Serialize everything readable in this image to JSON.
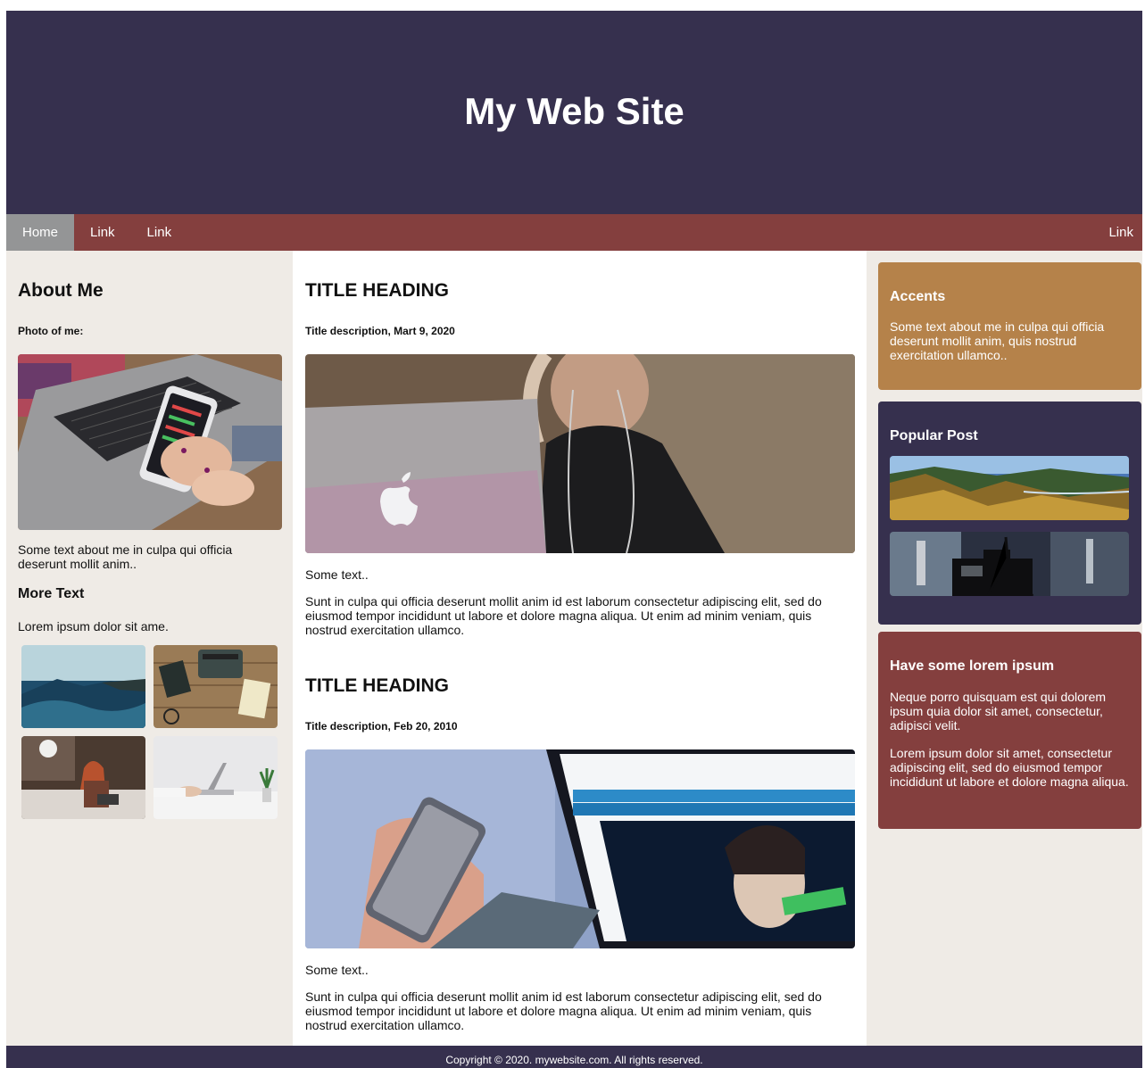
{
  "header": {
    "title": "My Web Site"
  },
  "nav": {
    "items": [
      {
        "label": "Home",
        "active": true
      },
      {
        "label": "Link",
        "active": false
      },
      {
        "label": "Link",
        "active": false
      }
    ],
    "right_item": {
      "label": "Link"
    }
  },
  "left": {
    "heading": "About Me",
    "photo_label": "Photo of me:",
    "photo_icon": "laptop-phone-photo",
    "about_text": "Some text about me in culpa qui officia deserunt mollit anim..",
    "more_heading": "More Text",
    "more_line": "Lorem ipsum dolor sit ame."
  },
  "articles": [
    {
      "title": "TITLE HEADING",
      "description": "Title description, Mart 9, 2020",
      "some_text": "Some text..",
      "body": "Sunt in culpa qui officia deserunt mollit anim id est laborum consectetur adipiscing elit, sed do eiusmod tempor incididunt ut labore et dolore magna aliqua. Ut enim ad minim veniam, quis nostrud exercitation ullamco."
    },
    {
      "title": "TITLE HEADING",
      "description": "Title description, Feb 20, 2010",
      "some_text": "Some text..",
      "body": "Sunt in culpa qui officia deserunt mollit anim id est laborum consectetur adipiscing elit, sed do eiusmod tempor incididunt ut labore et dolore magna aliqua. Ut enim ad minim veniam, quis nostrud exercitation ullamco."
    }
  ],
  "right": {
    "accents": {
      "title": "Accents",
      "text": "Some text about me in culpa qui officia deserunt mollit anim, quis nostrud exercitation ullamco.."
    },
    "popular": {
      "title": "Popular Post"
    },
    "lorem": {
      "title": "Have some lorem ipsum",
      "p1": "Neque porro quisquam est qui dolorem ipsum quia dolor sit amet, consectetur, adipisci velit.",
      "p2": "Lorem ipsum dolor sit amet, consectetur adipiscing elit, sed do eiusmod tempor incididunt ut labore et dolore magna aliqua."
    }
  },
  "footer": {
    "text": "Copyright © 2020. mywebsite.com. All rights reserved."
  },
  "colors": {
    "header_bg": "#36304e",
    "nav_bg": "#843f3e",
    "nav_active": "#949596",
    "side_bg": "#efebe6",
    "accent": "#b5824a"
  }
}
